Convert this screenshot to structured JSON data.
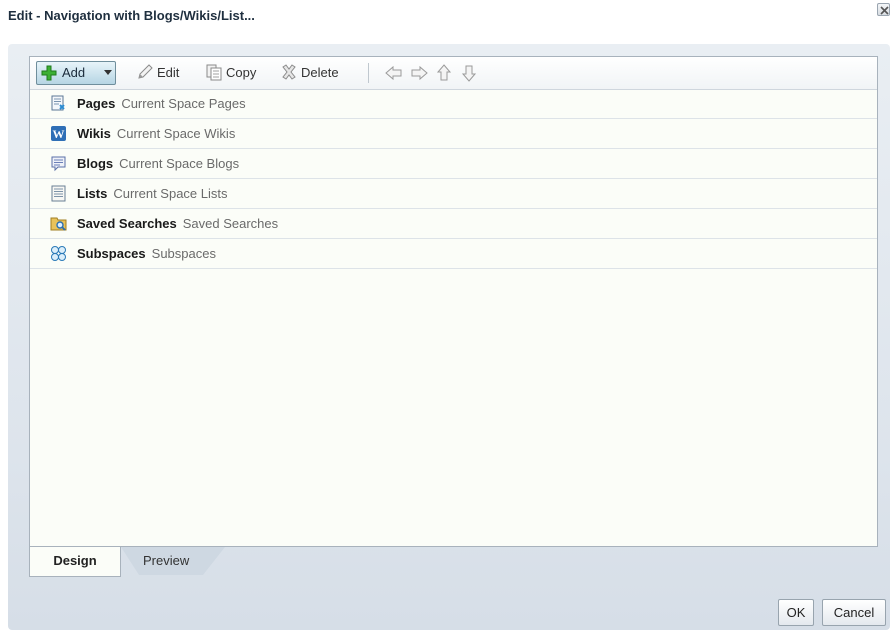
{
  "dialog": {
    "title": "Edit - Navigation with Blogs/Wikis/List..."
  },
  "toolbar": {
    "add_label": "Add",
    "edit_label": "Edit",
    "copy_label": "Copy",
    "delete_label": "Delete",
    "icons": [
      "plus-icon",
      "pencil-icon",
      "copy-icon",
      "delete-icon",
      "arrow-left-icon",
      "arrow-right-icon",
      "arrow-up-icon",
      "arrow-down-icon"
    ]
  },
  "items": [
    {
      "name": "Pages",
      "desc": "Current Space Pages",
      "icon": "pages-icon"
    },
    {
      "name": "Wikis",
      "desc": "Current Space Wikis",
      "icon": "wiki-icon"
    },
    {
      "name": "Blogs",
      "desc": "Current Space Blogs",
      "icon": "blog-icon"
    },
    {
      "name": "Lists",
      "desc": "Current Space Lists",
      "icon": "list-icon"
    },
    {
      "name": "Saved Searches",
      "desc": "Saved Searches",
      "icon": "saved-search-icon"
    },
    {
      "name": "Subspaces",
      "desc": "Subspaces",
      "icon": "subspaces-icon"
    }
  ],
  "tabs": [
    {
      "label": "Design",
      "selected": true
    },
    {
      "label": "Preview",
      "selected": false
    }
  ],
  "buttons": {
    "ok": "OK",
    "cancel": "Cancel"
  },
  "colors": {
    "accent": "#2a8ad0",
    "panel_bg": "#fbfdf8",
    "dialog_bg": "#e3e9ef"
  }
}
